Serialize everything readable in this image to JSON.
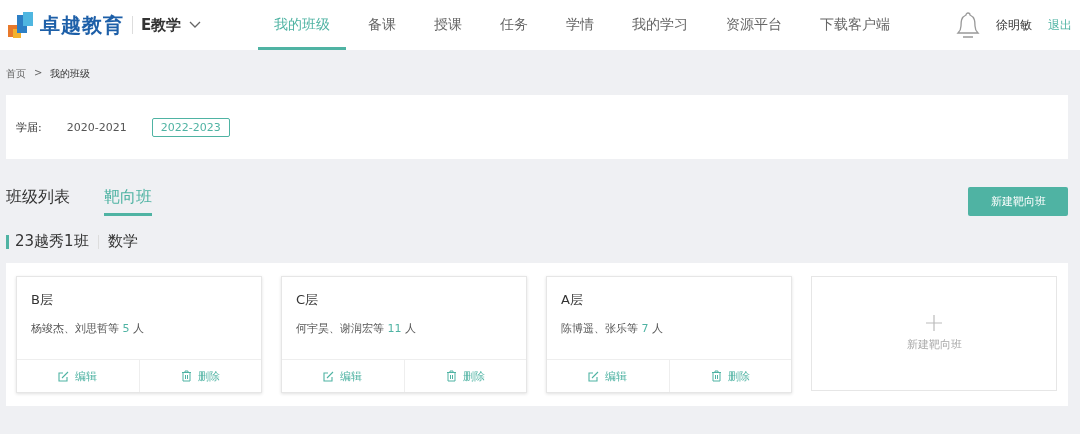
{
  "header": {
    "brand": "卓越教育",
    "product": "E教学",
    "nav": [
      {
        "label": "我的班级",
        "selected": true
      },
      {
        "label": "备课",
        "selected": false
      },
      {
        "label": "授课",
        "selected": false
      },
      {
        "label": "任务",
        "selected": false
      },
      {
        "label": "学情",
        "selected": false
      },
      {
        "label": "我的学习",
        "selected": false
      },
      {
        "label": "资源平台",
        "selected": false
      },
      {
        "label": "下载客户端",
        "selected": false
      }
    ],
    "user": "徐明敏",
    "logout": "退出"
  },
  "breadcrumb": [
    "首页",
    ">",
    "我的班级"
  ],
  "filter": {
    "label": "学届:",
    "options": [
      {
        "label": "2020-2021",
        "selected": false
      },
      {
        "label": "2022-2023",
        "selected": true
      }
    ]
  },
  "tabs": [
    {
      "label": "班级列表",
      "selected": false
    },
    {
      "label": "靶向班",
      "selected": true
    }
  ],
  "new_button": "新建靶向班",
  "section": {
    "class_name": "23越秀1班",
    "subject": "数学"
  },
  "cards": [
    {
      "title": "B层",
      "members": "杨竣杰、刘思哲等",
      "count": "5",
      "unit": "人",
      "actions": [
        {
          "kind": "edit",
          "label": "编辑"
        },
        {
          "kind": "delete",
          "label": "删除"
        }
      ]
    },
    {
      "title": "C层",
      "members": "何宇昊、谢润宏等",
      "count": "11",
      "unit": "人",
      "actions": [
        {
          "kind": "edit",
          "label": "编辑"
        },
        {
          "kind": "delete",
          "label": "删除"
        }
      ]
    },
    {
      "title": "A层",
      "members": "陈博遥、张乐等",
      "count": "7",
      "unit": "人",
      "actions": [
        {
          "kind": "edit",
          "label": "编辑"
        },
        {
          "kind": "delete",
          "label": "删除"
        }
      ]
    }
  ],
  "add_card": {
    "label": "新建靶向班"
  }
}
